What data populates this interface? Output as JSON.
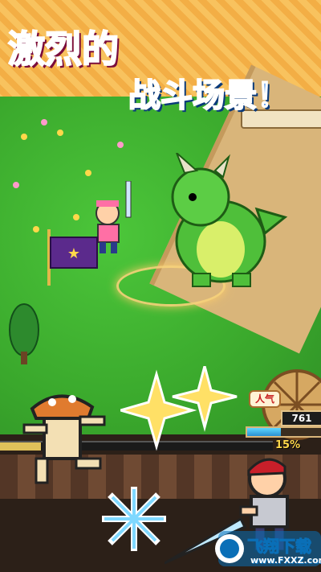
{
  "headline": {
    "line1": "激烈的",
    "line2": "战斗场景！"
  },
  "hud": {
    "popularity_label": "人气",
    "popularity_value": "761",
    "popularity_fill": 0.45,
    "progress_value": "15%",
    "progress_fill": 0.15
  },
  "watermark": {
    "brand": "飞翔下载",
    "url": "www.FXXZ.com"
  },
  "colors": {
    "accent_pink": "#ff4fa3",
    "accent_blue": "#2f7fe6",
    "grass": "#3aa82c",
    "dirt": "#d9b57a"
  },
  "icons": [
    "dragon-sprite",
    "hero-sprite",
    "flag-sprite",
    "mushroom-sprite",
    "knight-sprite",
    "sparkle-icon",
    "snowflake-icon",
    "tree-sprite"
  ]
}
